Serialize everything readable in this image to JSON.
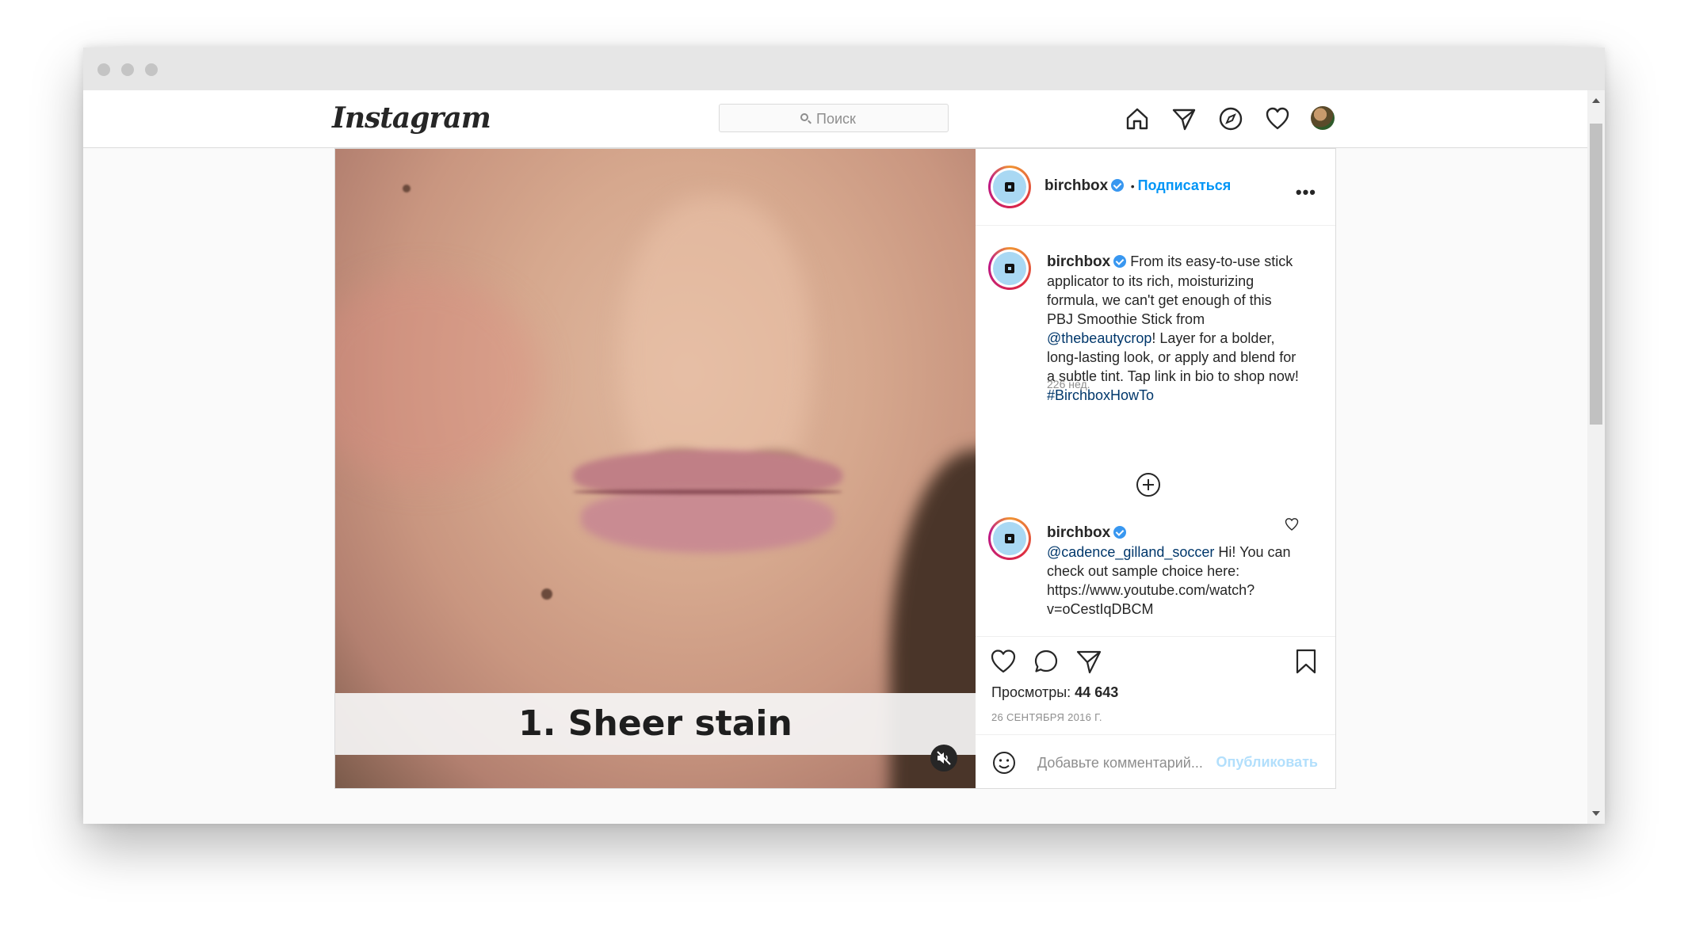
{
  "nav": {
    "logo": "Instagram",
    "search_placeholder": "Поиск",
    "icons": [
      "home-icon",
      "direct-icon",
      "explore-icon",
      "activity-icon",
      "profile-avatar"
    ]
  },
  "media": {
    "overlay_text": "1. Sheer stain",
    "muted": true
  },
  "post": {
    "username": "birchbox",
    "verified": true,
    "separator": "•",
    "follow_label": "Подписаться",
    "more_label": "•••"
  },
  "caption": {
    "username": "birchbox",
    "text_before_mention": "From its easy-to-use stick applicator to its rich, moisturizing formula, we can't get enough of this PBJ Smoothie Stick from",
    "mention": "@thebeautycrop",
    "text_after_mention": "! Layer for a bolder, long-lasting look, or apply and blend for a subtle tint. Tap link in bio to shop now!",
    "hashtag": "#BirchboxHowTo",
    "time": "226 нед."
  },
  "reply": {
    "username": "birchbox",
    "mention": "@cadence_gilland_soccer",
    "text": "Hi! You can check out sample choice here: https://www.youtube.com/watch?v=oCestIqDBCM"
  },
  "stats": {
    "views_label": "Просмотры:",
    "views_value": "44 643",
    "date": "26 СЕНТЯБРЯ 2016 Г."
  },
  "comment_box": {
    "placeholder": "Добавьте комментарий...",
    "publish_label": "Опубликовать"
  },
  "colors": {
    "accent": "#0095f6",
    "link": "#00376b",
    "publish_disabled": "#b2dffc",
    "verified": "#3897f0"
  }
}
